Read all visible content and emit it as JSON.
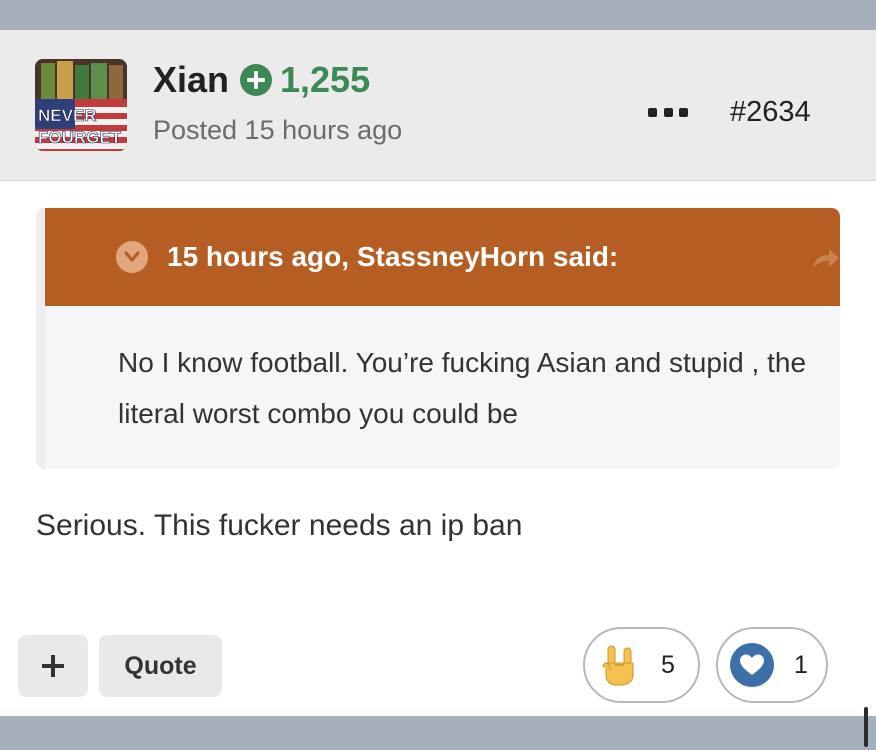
{
  "author": {
    "name": "Xian",
    "reputation": "1,255",
    "posted": "Posted 15 hours ago",
    "avatar_text_line1": "NEVER",
    "avatar_text_line2": "FOURGET"
  },
  "post_number": "#2634",
  "quote": {
    "title": "15 hours ago, StassneyHorn said:",
    "body": "No I know football. You’re fucking Asian and stupid , the literal worst combo you could be"
  },
  "content": "Serious. This fucker needs an ip ban",
  "actions": {
    "quote_label": "Quote"
  },
  "reactions": [
    {
      "icon": "rock-on-hand-icon",
      "count": "5"
    },
    {
      "icon": "heart-icon",
      "count": "1"
    }
  ],
  "colors": {
    "quote_header": "#b55d22",
    "reputation": "#3b8a54",
    "heart_reaction": "#3d6fa8"
  }
}
